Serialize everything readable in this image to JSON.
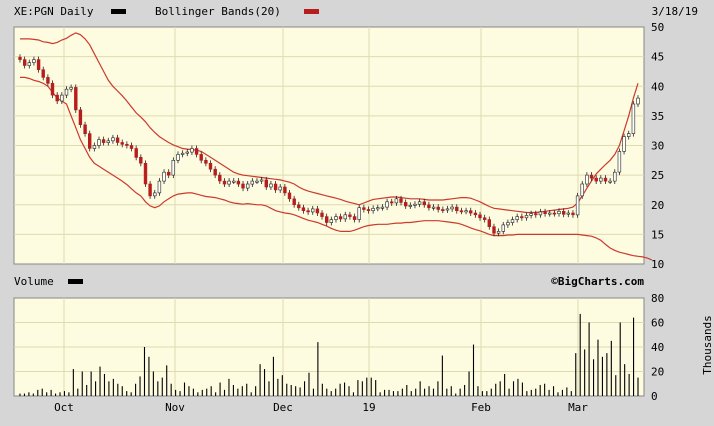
{
  "header": {
    "symbol_label": "XE:PGN Daily",
    "indicator_label": "Bollinger Bands(20)",
    "date": "3/18/19"
  },
  "volume_panel": {
    "label": "Volume",
    "watermark": "©BigCharts.com",
    "ylabel": "Thousands"
  },
  "colors": {
    "panel_bg": "#fdfbe0",
    "frame_bg": "#d6d6d6",
    "band_line": "#cc3a2c",
    "up_candle": "#ffffff",
    "down_candle": "#b81d1d",
    "grid": "#dedbb0",
    "volume_bar": "#000000"
  },
  "chart_data": [
    {
      "type": "candlestick",
      "series_name": "XE:PGN Daily",
      "x_ticks": [
        "Oct",
        "Nov",
        "Dec",
        "19",
        "Feb",
        "Mar"
      ],
      "y_ticks": [
        10,
        15,
        20,
        25,
        30,
        35,
        40,
        45,
        50
      ],
      "ylim": [
        10,
        50
      ],
      "grid": true,
      "close": [
        44.5,
        43.5,
        44,
        44.5,
        42.8,
        41.5,
        40.5,
        38.5,
        37.5,
        38.5,
        39.5,
        39.8,
        36,
        33.5,
        32,
        29.5,
        30,
        31,
        30.5,
        30.8,
        31.3,
        30.5,
        30.2,
        30,
        29.5,
        28,
        27,
        23.5,
        21.5,
        22,
        24,
        25.5,
        25,
        27.5,
        28.5,
        28.7,
        28.9,
        29.5,
        28.5,
        27.5,
        27,
        26,
        25,
        24,
        23.5,
        24,
        24,
        23.5,
        22.8,
        23.5,
        24,
        24,
        24.2,
        23,
        23.5,
        22.5,
        23,
        22,
        21,
        20,
        19.5,
        19,
        18.8,
        19.3,
        18.6,
        18,
        17,
        17.5,
        18,
        17.6,
        18.3,
        18,
        17.5,
        19.5,
        19.2,
        19,
        19.4,
        19.5,
        19.6,
        20.5,
        20.3,
        21,
        20.4,
        19.8,
        19.9,
        20.1,
        20.5,
        20,
        19.5,
        19.6,
        19.2,
        19.1,
        19.3,
        19.6,
        19,
        18.9,
        19,
        18.6,
        18.3,
        17.8,
        17.5,
        16.3,
        15.2,
        15.5,
        16.6,
        17,
        17.5,
        18,
        17.8,
        18.2,
        18.5,
        18.3,
        18.8,
        18.5,
        18.6,
        18.5,
        18.9,
        18.4,
        18.6,
        18.3,
        21.5,
        23.5,
        25,
        24.5,
        24,
        24.5,
        24,
        24,
        25.5,
        29,
        31.5,
        32,
        37,
        38
      ],
      "bollinger_upper": [
        48,
        48,
        48,
        47.9,
        47.8,
        47.5,
        47.4,
        47.2,
        47.4,
        47.8,
        48.1,
        48.6,
        49,
        48.7,
        48,
        47,
        45.5,
        44,
        42.5,
        41,
        40,
        39.2,
        38.4,
        37.5,
        36.5,
        35.5,
        34.8,
        34,
        33,
        32.2,
        31.5,
        31,
        30.5,
        30.1,
        29.8,
        29.5,
        29.4,
        29.3,
        29.2,
        29,
        28.5,
        28,
        27.5,
        27,
        26.5,
        26,
        25.5,
        25.2,
        25,
        24.9,
        24.8,
        24.7,
        24.6,
        24.5,
        24.4,
        24.3,
        24.2,
        24,
        23.8,
        23.5,
        23,
        22.6,
        22.3,
        22.1,
        21.9,
        21.7,
        21.5,
        21.3,
        21.1,
        20.9,
        20.6,
        20.4,
        20.2,
        20,
        20.3,
        20.6,
        20.9,
        21,
        21.1,
        21.2,
        21.3,
        21.3,
        21.2,
        21.1,
        21,
        21,
        21,
        20.9,
        20.8,
        20.8,
        20.8,
        20.8,
        20.9,
        21,
        21.1,
        21.2,
        21.2,
        21.1,
        20.8,
        20.5,
        20.1,
        19.7,
        19.4,
        19.3,
        19.2,
        19.1,
        19,
        18.9,
        18.8,
        18.7,
        18.7,
        18.7,
        18.8,
        18.9,
        19,
        19.1,
        19.2,
        19.3,
        19.4,
        19.6,
        20.3,
        21.5,
        22.8,
        24,
        25.2,
        26,
        26.8,
        27.5,
        28.5,
        30,
        32.5,
        35,
        38,
        40.5
      ],
      "bollinger_lower": [
        41.5,
        41.5,
        41.3,
        41,
        40.8,
        40.5,
        40,
        39,
        38,
        37.5,
        37,
        35,
        33,
        31,
        29.5,
        28,
        27,
        26.5,
        26,
        25.5,
        25,
        24.5,
        24,
        23.4,
        22.7,
        22,
        21.5,
        20.5,
        19.8,
        19.5,
        19.8,
        20.5,
        21,
        21.5,
        21.8,
        21.9,
        22,
        22,
        21.8,
        21.6,
        21.4,
        21.3,
        21.2,
        21,
        20.8,
        20.5,
        20.3,
        20.2,
        20.1,
        20.2,
        20.1,
        20,
        20,
        19.8,
        19.4,
        19,
        18.8,
        18.6,
        18.5,
        18.3,
        18,
        17.7,
        17.4,
        17.2,
        17,
        16.7,
        16.4,
        16,
        15.7,
        15.5,
        15.5,
        15.5,
        15.7,
        16,
        16.3,
        16.5,
        16.6,
        16.7,
        16.7,
        16.7,
        16.8,
        16.9,
        16.9,
        17,
        17,
        17.1,
        17.2,
        17.3,
        17.3,
        17.3,
        17.3,
        17.2,
        17.1,
        17,
        16.9,
        16.7,
        16.4,
        16.1,
        15.8,
        15.6,
        15.3,
        15,
        14.8,
        14.8,
        14.8,
        14.9,
        14.9,
        15,
        15,
        15,
        15,
        15,
        15,
        15,
        15,
        15,
        15,
        15,
        15,
        15,
        15,
        14.9,
        14.8,
        14.7,
        14.4,
        14,
        13.3,
        12.7,
        12.3,
        12,
        11.8,
        11.6,
        11.4,
        11.3,
        11.2,
        11,
        10.7
      ]
    },
    {
      "type": "bar",
      "series_name": "Volume",
      "ylabel": "Thousands",
      "y_ticks": [
        0,
        20,
        40,
        60,
        80
      ],
      "ylim": [
        0,
        80
      ],
      "x_ticks": [
        "Oct",
        "Nov",
        "Dec",
        "19",
        "Feb",
        "Mar"
      ],
      "values": [
        2,
        2,
        3,
        2,
        5,
        6,
        3,
        5,
        2,
        3,
        4,
        3,
        22,
        6,
        20,
        9,
        20,
        12,
        24,
        18,
        12,
        14,
        10,
        8,
        4,
        3,
        10,
        16,
        40,
        32,
        20,
        12,
        15,
        25,
        10,
        5,
        4,
        11,
        8,
        6,
        3,
        5,
        6,
        8,
        3,
        11,
        5,
        14,
        9,
        6,
        8,
        10,
        3,
        8,
        26,
        22,
        12,
        32,
        14,
        17,
        10,
        9,
        8,
        7,
        12,
        19,
        6,
        44,
        10,
        6,
        4,
        6,
        10,
        11,
        8,
        3,
        13,
        12,
        15,
        15,
        13,
        3,
        5,
        5,
        4,
        4,
        6,
        9,
        4,
        6,
        12,
        6,
        8,
        6,
        12,
        33,
        6,
        8,
        2,
        6,
        9,
        20,
        42,
        8,
        4,
        4,
        6,
        10,
        12,
        18,
        6,
        12,
        14,
        11,
        4,
        5,
        6,
        9,
        10,
        5,
        8,
        3,
        5,
        7,
        4,
        35,
        67,
        38,
        60,
        30,
        46,
        32,
        35,
        45,
        17,
        60,
        26,
        18,
        64,
        15
      ]
    }
  ]
}
